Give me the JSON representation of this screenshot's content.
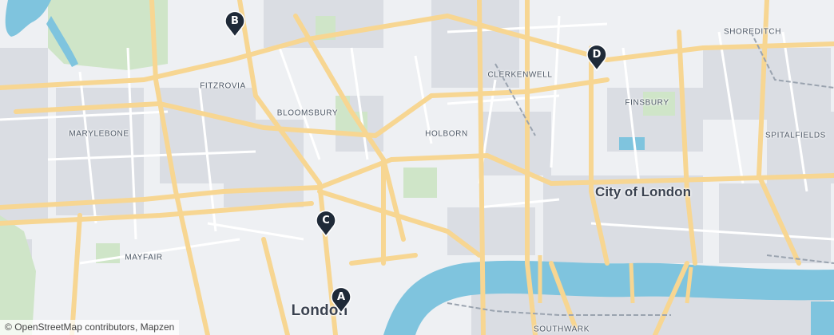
{
  "map": {
    "colors": {
      "land": "#eef0f3",
      "road": "#f7d692",
      "road_casing": "#e9c27a",
      "water": "#7fc4de",
      "park": "#cfe5c8",
      "block": "#dadde3",
      "marker": "#1f2a38"
    },
    "places": {
      "shoreditch": "SHOREDITCH",
      "clerkenwell": "CLERKENWELL",
      "finsbury": "FINSBURY",
      "fitzrovia": "FITZROVIA",
      "bloomsbury": "BLOOMSBURY",
      "marylebone": "MARYLEBONE",
      "holborn": "HOLBORN",
      "spitalfields": "SPITALFIELDS",
      "city_of_london": "City of London",
      "mayfair": "MAYFAIR",
      "london": "London",
      "southwark": "SOUTHWARK"
    },
    "markers": [
      {
        "label": "A",
        "icon": "map-pin-icon"
      },
      {
        "label": "B",
        "icon": "map-pin-icon"
      },
      {
        "label": "C",
        "icon": "map-pin-icon"
      },
      {
        "label": "D",
        "icon": "map-pin-icon"
      }
    ],
    "attribution": {
      "symbol": "©",
      "osm": "OpenStreetMap contributors",
      "separator": ", ",
      "mapzen": "Mapzen"
    }
  }
}
